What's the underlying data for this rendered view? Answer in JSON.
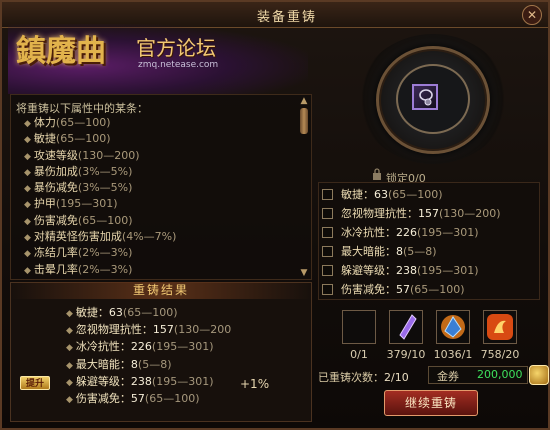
{
  "window": {
    "title": "装备重铸",
    "close_label": "✕"
  },
  "logo": {
    "big": "鎮魔曲",
    "sub": "官方论坛",
    "url": "zmq.netease.com"
  },
  "attributes": {
    "hint": "将重铸以下属性中的某条：",
    "items": [
      {
        "name": "体力",
        "range": "(65—100)"
      },
      {
        "name": "敏捷",
        "range": "(65—100)"
      },
      {
        "name": "攻速等级",
        "range": "(130—200)"
      },
      {
        "name": "暴伤加成",
        "range": "(3%—5%)"
      },
      {
        "name": "暴伤减免",
        "range": "(3%—5%)"
      },
      {
        "name": "护甲",
        "range": "(195—301)"
      },
      {
        "name": "伤害减免",
        "range": "(65—100)"
      },
      {
        "name": "对精英怪伤害加成",
        "range": "(4%—7%)"
      },
      {
        "name": "冻结几率",
        "range": "(2%—3%)"
      },
      {
        "name": "击晕几率",
        "range": "(2%—3%)"
      }
    ]
  },
  "result": {
    "title": "重铸结果",
    "items": [
      {
        "name": "敏捷：",
        "value": "63",
        "range": "(65—100)"
      },
      {
        "name": "忽视物理抗性：",
        "value": "157",
        "range": "(130—200"
      },
      {
        "name": "冰冷抗性：",
        "value": "226",
        "range": "(195—301)"
      },
      {
        "name": "最大暗能：",
        "value": "8",
        "range": "(5—8)"
      },
      {
        "name": "躲避等级：",
        "value": "238",
        "range": "(195—301)"
      },
      {
        "name": "伤害减免：",
        "value": "57",
        "range": "(65—100)"
      }
    ],
    "badge": "提升",
    "bonus": "+1%"
  },
  "lock": {
    "label": "锁定0/0"
  },
  "current": {
    "items": [
      {
        "name": "敏捷：",
        "value": "63",
        "range": "(65—100)"
      },
      {
        "name": "忽视物理抗性：",
        "value": "157",
        "range": "(130—200)"
      },
      {
        "name": "冰冷抗性：",
        "value": "226",
        "range": "(195—301)"
      },
      {
        "name": "最大暗能：",
        "value": "8",
        "range": "(5—8)"
      },
      {
        "name": "躲避等级：",
        "value": "238",
        "range": "(195—301)"
      },
      {
        "name": "伤害减免：",
        "value": "57",
        "range": "(65—100)"
      }
    ]
  },
  "materials": [
    {
      "count": "0/1",
      "icon": "empty-slot"
    },
    {
      "count": "379/10",
      "icon": "purple-crystal-icon"
    },
    {
      "count": "1036/1",
      "icon": "blue-gem-icon"
    },
    {
      "count": "758/20",
      "icon": "fire-rune-icon"
    }
  ],
  "footer": {
    "reforge_label": "已重铸次数：",
    "reforge_value": "2/10",
    "gold_label": "金券",
    "gold_value": "200,000",
    "button": "继续重铸"
  },
  "colors": {
    "accent": "#f1c873",
    "gold_green": "#3ee05c",
    "button_red": "#a32d22"
  }
}
